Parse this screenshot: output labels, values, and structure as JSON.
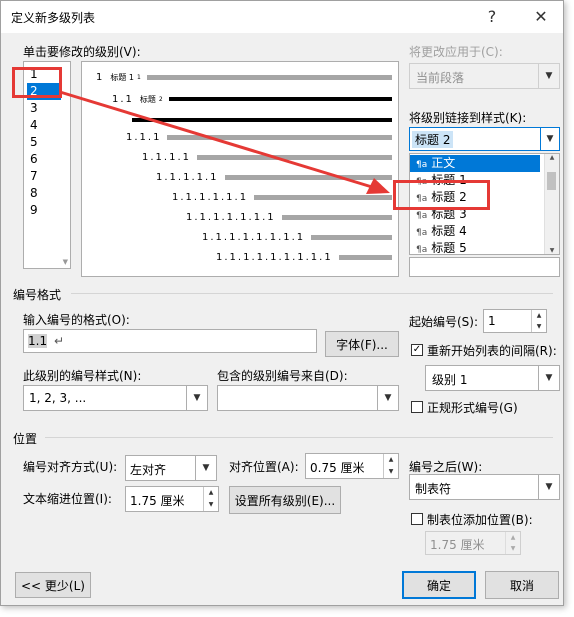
{
  "dialog": {
    "title": "定义新多级列表",
    "help_glyph": "?",
    "close_glyph": "✕"
  },
  "levels": {
    "label": "单击要修改的级别(V):",
    "items": [
      "1",
      "2",
      "3",
      "4",
      "5",
      "6",
      "7",
      "8",
      "9"
    ],
    "selected": "2"
  },
  "preview": {
    "rows": [
      {
        "num": "1",
        "tag": "标题 1",
        "sub": "1"
      },
      {
        "num": "1.1",
        "tag": "标题",
        "sub": "2"
      },
      {
        "num": "1.1.1",
        "tag": "",
        "sub": ""
      },
      {
        "num": "1.1.1.1",
        "tag": "",
        "sub": ""
      },
      {
        "num": "1.1.1.1.1",
        "tag": "",
        "sub": ""
      },
      {
        "num": "1.1.1.1.1.1",
        "tag": "",
        "sub": ""
      },
      {
        "num": "1.1.1.1.1.1.1",
        "tag": "",
        "sub": ""
      },
      {
        "num": "1.1.1.1.1.1.1.1",
        "tag": "",
        "sub": ""
      },
      {
        "num": "1.1.1.1.1.1.1.1.1",
        "tag": "",
        "sub": ""
      }
    ]
  },
  "apply_to": {
    "label": "将更改应用于(C):",
    "value": "当前段落"
  },
  "link_style": {
    "label": "将级别链接到样式(K):",
    "value": "标题 2",
    "list": [
      "正文",
      "标题 1",
      "标题 2",
      "标题 3",
      "标题 4",
      "标题 5"
    ],
    "selected": "正文",
    "icon_glyph": "¶a"
  },
  "number_format": {
    "section": "编号格式",
    "format_label": "输入编号的格式(O):",
    "format_value": "1.1",
    "format_mark": "↵",
    "font_button": "字体(F)...",
    "style_label": "此级别的编号样式(N):",
    "style_value": "1, 2, 3, ...",
    "include_label": "包含的级别编号来自(D):",
    "include_value": ""
  },
  "start": {
    "label": "起始编号(S):",
    "value": "1",
    "restart_label": "重新开始列表的间隔(R):",
    "restart_checked": true,
    "restart_value": "级别 1",
    "legal_label": "正规形式编号(G)",
    "legal_checked": false
  },
  "position": {
    "section": "位置",
    "align_label": "编号对齐方式(U):",
    "align_value": "左对齐",
    "at_label": "对齐位置(A):",
    "at_value": "0.75 厘米",
    "indent_label": "文本缩进位置(I):",
    "indent_value": "1.75 厘米",
    "set_all_button": "设置所有级别(E)...",
    "follow_label": "编号之后(W):",
    "follow_value": "制表符",
    "tab_label": "制表位添加位置(B):",
    "tab_checked": false,
    "tab_value": "1.75 厘米"
  },
  "buttons": {
    "less": "<< 更少(L)",
    "ok": "确定",
    "cancel": "取消"
  },
  "colors": {
    "selection": "#0078d7",
    "annotation": "#e53935"
  }
}
